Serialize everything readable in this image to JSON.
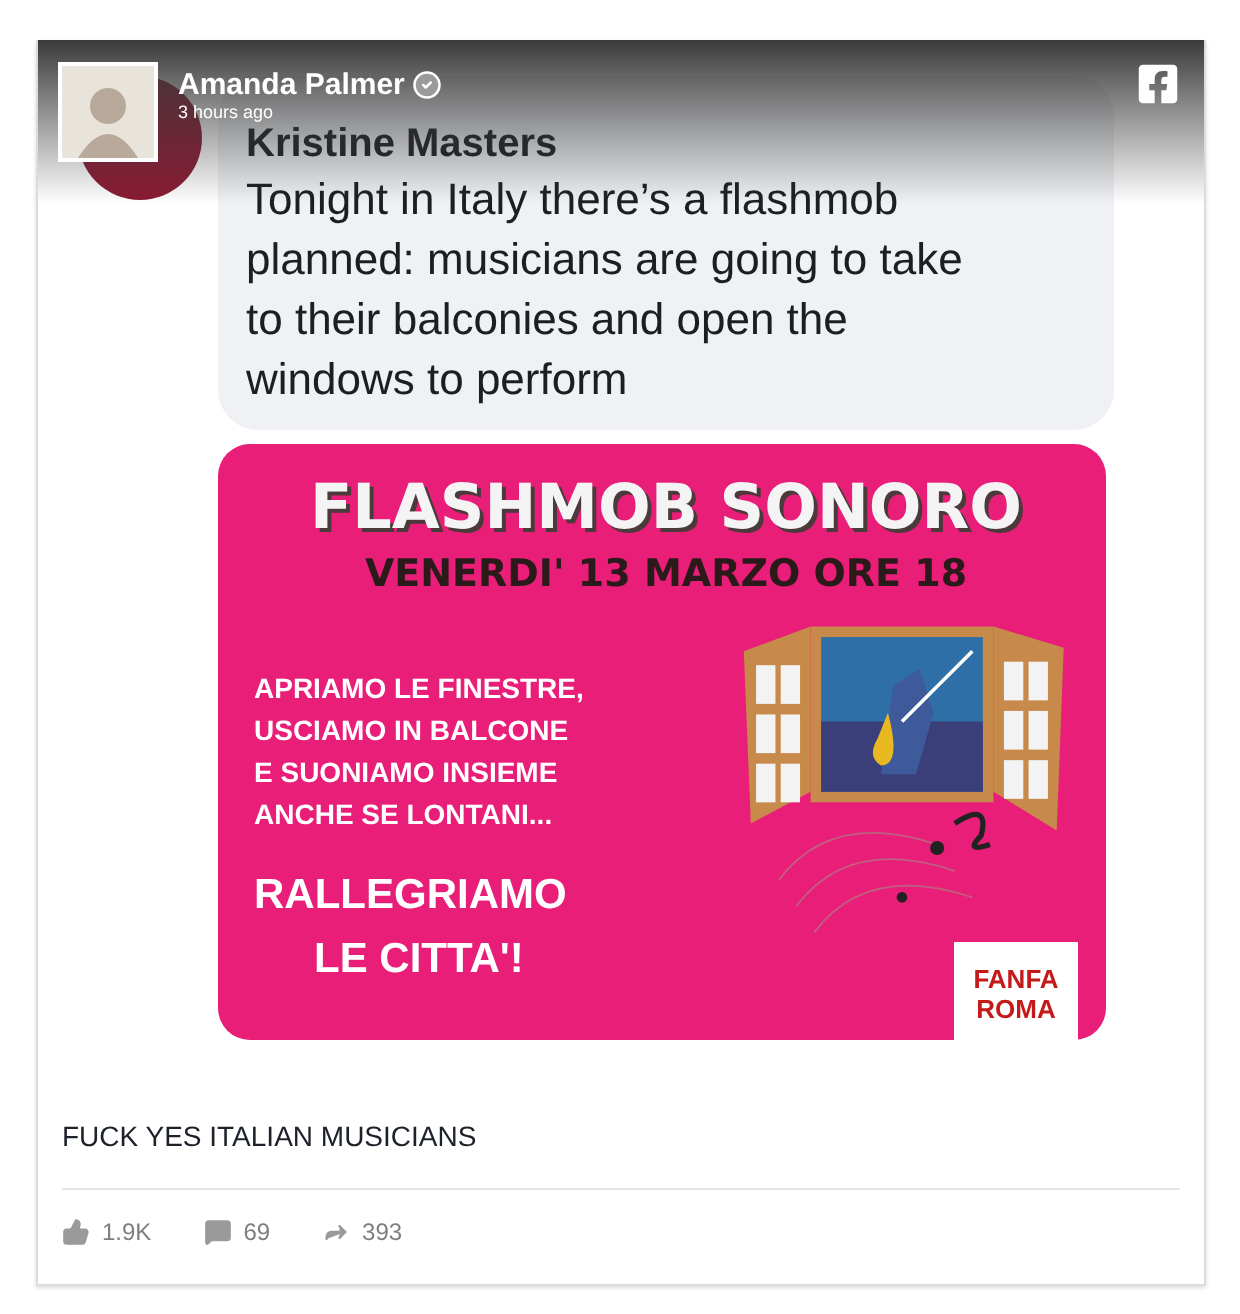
{
  "post": {
    "author": "Amanda Palmer",
    "verified": true,
    "time": "3 hours ago",
    "caption": "FUCK YES ITALIAN MUSICIANS",
    "stats": [
      {
        "kind": "likes",
        "count": "1.9K"
      },
      {
        "kind": "comments",
        "count": "69"
      },
      {
        "kind": "shares",
        "count": "393"
      }
    ]
  },
  "comment": {
    "author": "Kristine Masters",
    "text": "Tonight in Italy there’s a flashmob planned: musicians are going to take to their balconies and open the windows to perform"
  },
  "poster": {
    "title": "FLASHMOB SONORO",
    "date": "VENERDI' 13 MARZO ORE 18",
    "message": [
      "APRIAMO LE FINESTRE,",
      "USCIAMO IN BALCONE",
      "E SUONIAMO INSIEME",
      "ANCHE SE LONTANI..."
    ],
    "slogan": [
      "RALLEGRIAMO",
      "LE CITTA'!"
    ],
    "logo": [
      "FANFA",
      "ROMA"
    ]
  }
}
